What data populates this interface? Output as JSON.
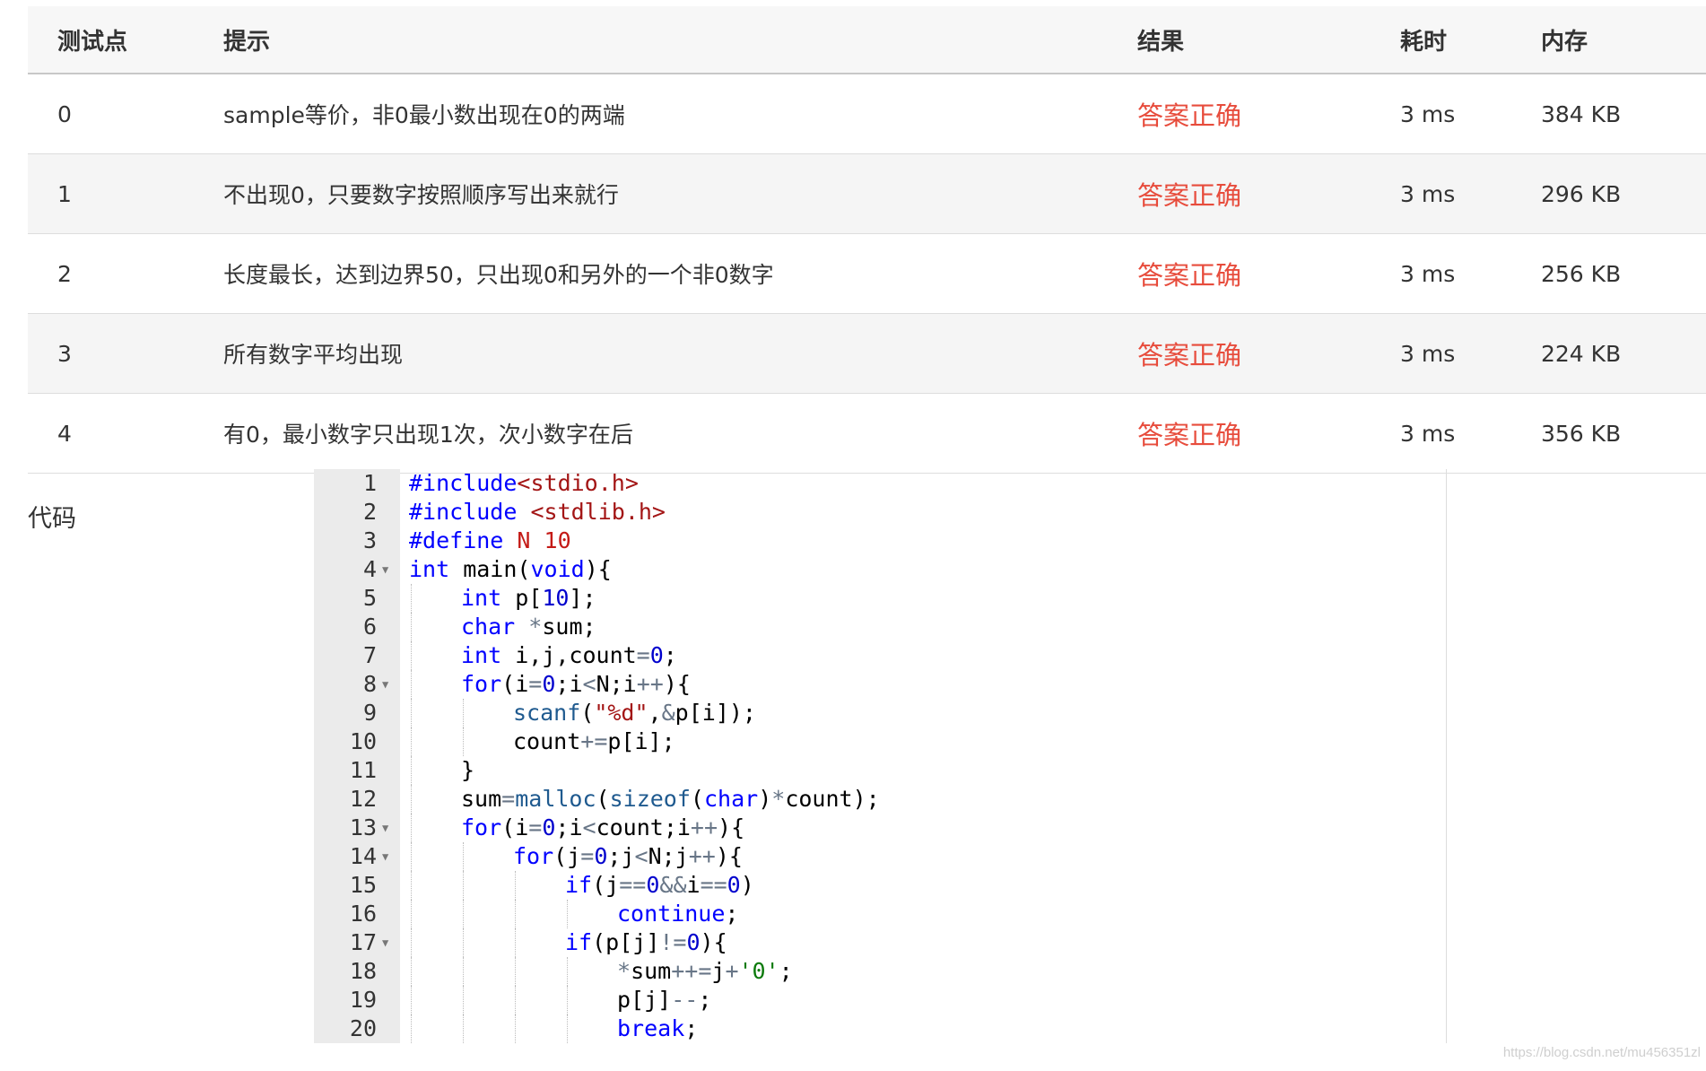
{
  "table": {
    "headers": {
      "point": "测试点",
      "hint": "提示",
      "result": "结果",
      "time": "耗时",
      "memory": "内存"
    },
    "rows": [
      {
        "point": "0",
        "hint": "sample等价，非0最小数出现在0的两端",
        "result": "答案正确",
        "time": "3 ms",
        "memory": "384 KB"
      },
      {
        "point": "1",
        "hint": "不出现0，只要数字按照顺序写出来就行",
        "result": "答案正确",
        "time": "3 ms",
        "memory": "296 KB"
      },
      {
        "point": "2",
        "hint": "长度最长，达到边界50，只出现0和另外的一个非0数字",
        "result": "答案正确",
        "time": "3 ms",
        "memory": "256 KB"
      },
      {
        "point": "3",
        "hint": "所有数字平均出现",
        "result": "答案正确",
        "time": "3 ms",
        "memory": "224 KB"
      },
      {
        "point": "4",
        "hint": "有0，最小数字只出现1次，次小数字在后",
        "result": "答案正确",
        "time": "3 ms",
        "memory": "356 KB"
      }
    ],
    "result_color": "#e74c3c"
  },
  "code": {
    "label": "代码",
    "lines": [
      {
        "n": "1",
        "indent": 0,
        "fold": false,
        "tokens": [
          [
            "k",
            "#include"
          ],
          [
            "s",
            "<stdio.h>"
          ]
        ]
      },
      {
        "n": "2",
        "indent": 0,
        "fold": false,
        "tokens": [
          [
            "k",
            "#include "
          ],
          [
            "s",
            "<stdlib.h>"
          ]
        ]
      },
      {
        "n": "3",
        "indent": 0,
        "fold": false,
        "tokens": [
          [
            "k",
            "#define "
          ],
          [
            "c",
            "N "
          ],
          [
            "c",
            "10"
          ]
        ]
      },
      {
        "n": "4",
        "indent": 0,
        "fold": true,
        "tokens": [
          [
            "k",
            "int"
          ],
          [
            "t",
            " main("
          ],
          [
            "k",
            "void"
          ],
          [
            "t",
            "){"
          ]
        ]
      },
      {
        "n": "5",
        "indent": 1,
        "fold": false,
        "tokens": [
          [
            "k",
            "int"
          ],
          [
            "t",
            " p["
          ],
          [
            "n",
            "10"
          ],
          [
            "t",
            "];"
          ]
        ]
      },
      {
        "n": "6",
        "indent": 1,
        "fold": false,
        "tokens": [
          [
            "k",
            "char"
          ],
          [
            "t",
            " "
          ],
          [
            "o",
            "*"
          ],
          [
            "t",
            "sum;"
          ]
        ]
      },
      {
        "n": "7",
        "indent": 1,
        "fold": false,
        "tokens": [
          [
            "k",
            "int"
          ],
          [
            "t",
            " i,j,count"
          ],
          [
            "o",
            "="
          ],
          [
            "n",
            "0"
          ],
          [
            "t",
            ";"
          ]
        ]
      },
      {
        "n": "8",
        "indent": 1,
        "fold": true,
        "tokens": [
          [
            "k",
            "for"
          ],
          [
            "t",
            "(i"
          ],
          [
            "o",
            "="
          ],
          [
            "n",
            "0"
          ],
          [
            "t",
            ";i"
          ],
          [
            "o",
            "<"
          ],
          [
            "t",
            "N;i"
          ],
          [
            "o",
            "++"
          ],
          [
            "t",
            "){"
          ]
        ]
      },
      {
        "n": "9",
        "indent": 2,
        "fold": false,
        "tokens": [
          [
            "f",
            "scanf"
          ],
          [
            "t",
            "("
          ],
          [
            "s",
            "\"%d\""
          ],
          [
            "t",
            ","
          ],
          [
            "o",
            "&"
          ],
          [
            "t",
            "p[i]);"
          ]
        ]
      },
      {
        "n": "10",
        "indent": 2,
        "fold": false,
        "tokens": [
          [
            "t",
            "count"
          ],
          [
            "o",
            "+="
          ],
          [
            "t",
            "p[i];"
          ]
        ]
      },
      {
        "n": "11",
        "indent": 1,
        "fold": false,
        "tokens": [
          [
            "t",
            "}"
          ]
        ]
      },
      {
        "n": "12",
        "indent": 1,
        "fold": false,
        "tokens": [
          [
            "t",
            "sum"
          ],
          [
            "o",
            "="
          ],
          [
            "f",
            "malloc"
          ],
          [
            "t",
            "("
          ],
          [
            "f",
            "sizeof"
          ],
          [
            "t",
            "("
          ],
          [
            "k",
            "char"
          ],
          [
            "t",
            ")"
          ],
          [
            "o",
            "*"
          ],
          [
            "t",
            "count);"
          ]
        ]
      },
      {
        "n": "13",
        "indent": 1,
        "fold": true,
        "tokens": [
          [
            "k",
            "for"
          ],
          [
            "t",
            "(i"
          ],
          [
            "o",
            "="
          ],
          [
            "n",
            "0"
          ],
          [
            "t",
            ";i"
          ],
          [
            "o",
            "<"
          ],
          [
            "t",
            "count;i"
          ],
          [
            "o",
            "++"
          ],
          [
            "t",
            "){"
          ]
        ]
      },
      {
        "n": "14",
        "indent": 2,
        "fold": true,
        "tokens": [
          [
            "k",
            "for"
          ],
          [
            "t",
            "(j"
          ],
          [
            "o",
            "="
          ],
          [
            "n",
            "0"
          ],
          [
            "t",
            ";j"
          ],
          [
            "o",
            "<"
          ],
          [
            "t",
            "N;j"
          ],
          [
            "o",
            "++"
          ],
          [
            "t",
            "){"
          ]
        ]
      },
      {
        "n": "15",
        "indent": 3,
        "fold": false,
        "tokens": [
          [
            "k",
            "if"
          ],
          [
            "t",
            "(j"
          ],
          [
            "o",
            "=="
          ],
          [
            "n",
            "0"
          ],
          [
            "o",
            "&&"
          ],
          [
            "t",
            "i"
          ],
          [
            "o",
            "=="
          ],
          [
            "n",
            "0"
          ],
          [
            "t",
            ")"
          ]
        ]
      },
      {
        "n": "16",
        "indent": 4,
        "fold": false,
        "tokens": [
          [
            "k",
            "continue"
          ],
          [
            "t",
            ";"
          ]
        ]
      },
      {
        "n": "17",
        "indent": 3,
        "fold": true,
        "tokens": [
          [
            "k",
            "if"
          ],
          [
            "t",
            "(p[j]"
          ],
          [
            "o",
            "!="
          ],
          [
            "n",
            "0"
          ],
          [
            "t",
            "){"
          ]
        ]
      },
      {
        "n": "18",
        "indent": 4,
        "fold": false,
        "tokens": [
          [
            "o",
            "*"
          ],
          [
            "t",
            "sum"
          ],
          [
            "o",
            "++="
          ],
          [
            "t",
            "j"
          ],
          [
            "o",
            "+"
          ],
          [
            "q",
            "'0'"
          ],
          [
            "t",
            ";"
          ]
        ]
      },
      {
        "n": "19",
        "indent": 4,
        "fold": false,
        "tokens": [
          [
            "t",
            "p[j]"
          ],
          [
            "o",
            "--"
          ],
          [
            "t",
            ";"
          ]
        ]
      },
      {
        "n": "20",
        "indent": 4,
        "fold": false,
        "tokens": [
          [
            "k",
            "break"
          ],
          [
            "t",
            ";"
          ]
        ]
      }
    ]
  },
  "watermark": "https://blog.csdn.net/mu456351zl"
}
